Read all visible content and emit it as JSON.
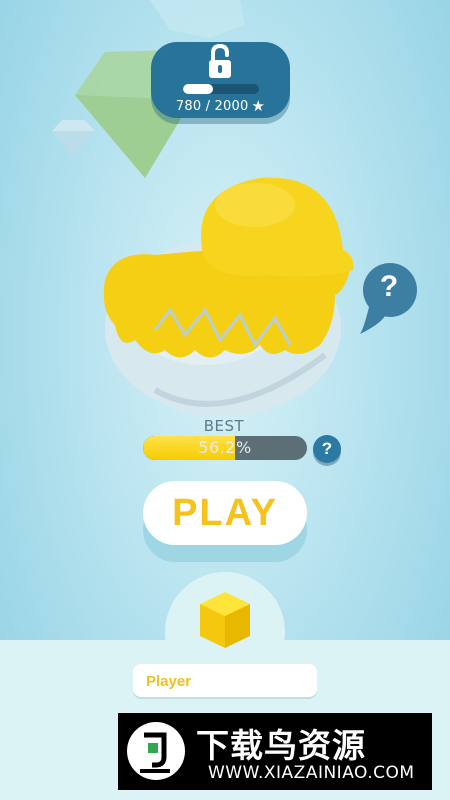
{
  "unlock": {
    "progress_text": "780 / 2000",
    "star_glyph": "★",
    "current": 780,
    "goal": 2000,
    "progress_fraction": 0.39
  },
  "character": {
    "name_icon": "duck-icon"
  },
  "help": {
    "glyph": "?"
  },
  "best": {
    "label": "BEST",
    "percent_text": "56.2%",
    "percent_value": 56.2,
    "help_glyph": "?"
  },
  "play": {
    "label": "PLAY"
  },
  "player": {
    "name": "Player"
  },
  "watermark": {
    "text": "下载鸟资源",
    "url": "WWW.XIAZAINIAO.COM"
  },
  "colors": {
    "accent_yellow": "#f7c21b",
    "badge_blue": "#27739a",
    "bar_gray": "#5d6f76"
  }
}
